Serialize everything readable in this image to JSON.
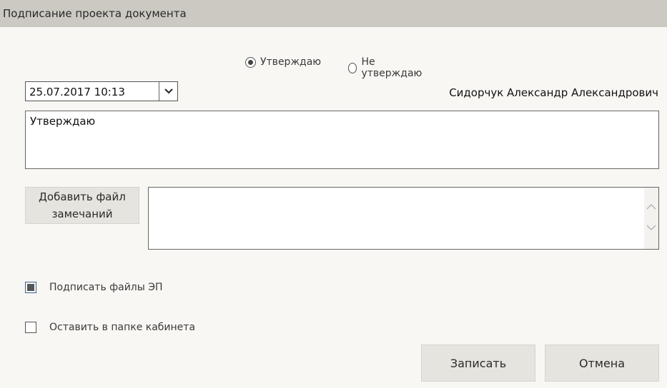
{
  "window": {
    "title": "Подписание проекта документа"
  },
  "decision": {
    "options": [
      {
        "label": "Утверждаю",
        "selected": true
      },
      {
        "label": "Не утверждаю",
        "selected": false
      }
    ]
  },
  "datetime": {
    "value": "25.07.2017 10:13",
    "dropdown_icon": "chevron-down-icon"
  },
  "signer": {
    "name": "Сидорчук Александр Александрович"
  },
  "comment": {
    "value": "Утверждаю"
  },
  "attachments": {
    "add_button_label_line1": "Добавить файл",
    "add_button_label_line2": "замечаний",
    "files": []
  },
  "options": {
    "sign_files": {
      "label": "Подписать файлы ЭП",
      "checked": true
    },
    "keep_in_folder": {
      "label": "Оставить в папке кабинета",
      "checked": false
    }
  },
  "actions": {
    "save_label": "Записать",
    "cancel_label": "Отмена"
  }
}
